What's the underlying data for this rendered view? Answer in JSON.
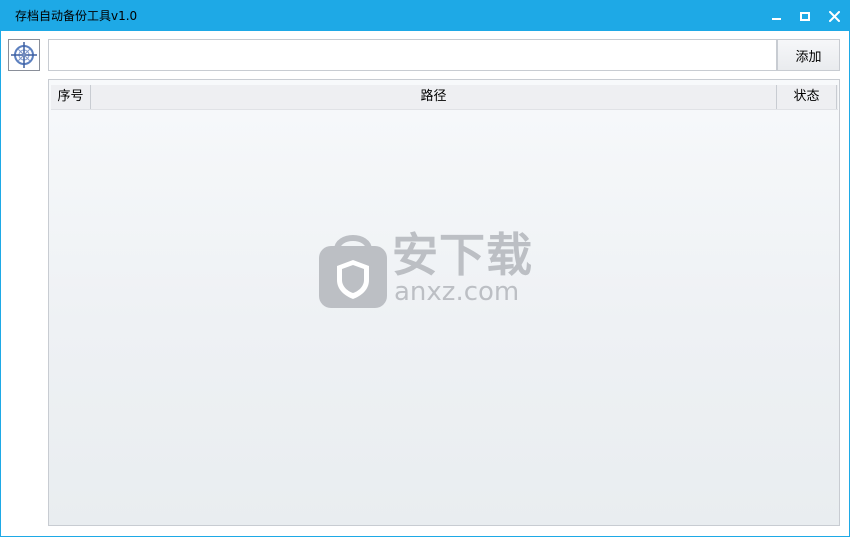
{
  "window": {
    "title": "存档自动备份工具v1.0"
  },
  "toolbar": {
    "path_value": "",
    "add_label": "添加"
  },
  "table": {
    "columns": [
      "序号",
      "路径",
      "状态"
    ],
    "rows": []
  },
  "watermark": {
    "cn": "安下载",
    "en": "anxz.com"
  },
  "colors": {
    "titlebar": "#1ea9e6",
    "window_border": "#1ea9e6",
    "watermark": "#bcbfc4"
  },
  "icons": {
    "logo": "crosshair-compass-icon",
    "minimize": "minimize-icon",
    "maximize": "maximize-icon",
    "close": "close-icon",
    "watermark": "shield-bag-icon"
  }
}
